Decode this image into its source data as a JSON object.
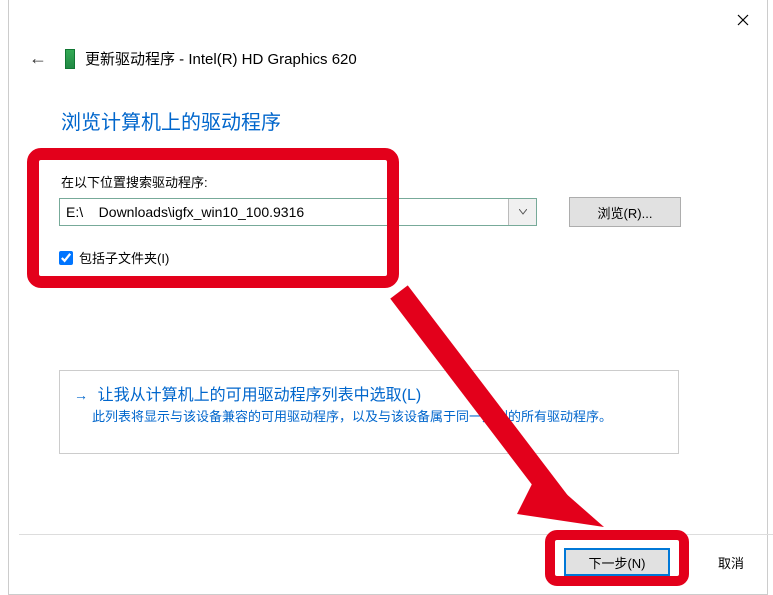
{
  "title_prefix": "更新驱动程序 - ",
  "device_name": "Intel(R) HD Graphics 620",
  "heading": "浏览计算机上的驱动程序",
  "search_label": "在以下位置搜索驱动程序:",
  "path_value": "E:\\    Downloads\\igfx_win10_100.9316",
  "browse_button": "浏览(R)...",
  "include_subfolders": "包括子文件夹(I)",
  "include_subfolders_checked": true,
  "option": {
    "title": "让我从计算机上的可用驱动程序列表中选取(L)",
    "desc": "此列表将显示与该设备兼容的可用驱动程序，以及与该设备属于同一类别的所有驱动程序。"
  },
  "next_button": "下一步(N)",
  "cancel_button": "取消",
  "colors": {
    "accent": "#0066cc",
    "annotation": "#e3001b"
  }
}
